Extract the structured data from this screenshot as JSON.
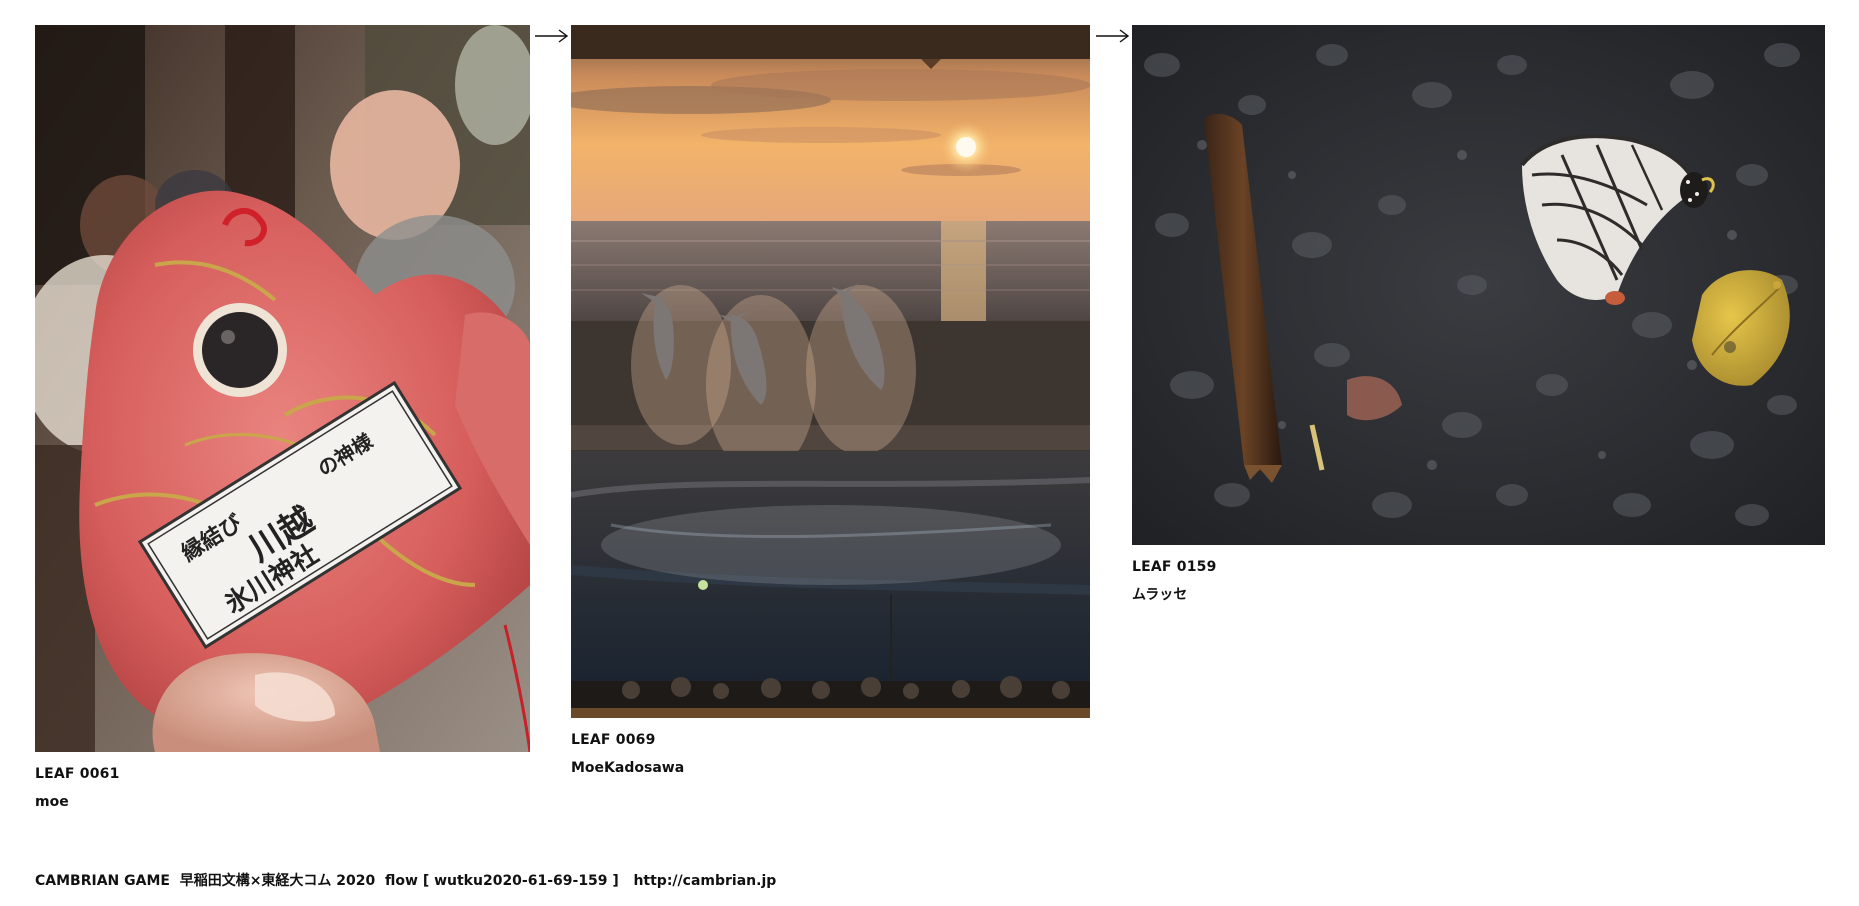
{
  "leaves": [
    {
      "id": "LEAF 0061",
      "author": "moe",
      "image": {
        "subject": "red sea-bream charm with paper label",
        "label_text": [
          "縁結び",
          "川越",
          "氷川神社",
          "の神様"
        ]
      }
    },
    {
      "id": "LEAF 0069",
      "author": "MoeKadosawa",
      "image": {
        "subject": "dolphins jumping at sunset aquarium show"
      }
    },
    {
      "id": "LEAF 0159",
      "author": "ムラッセ",
      "image": {
        "subject": "butterfly, twig and yellow leaf on wet asphalt"
      }
    }
  ],
  "arrows": [
    "right-arrow-icon",
    "right-arrow-icon"
  ],
  "footer": {
    "text": "CAMBRIAN GAME  早稲田文構×東経大コム 2020  flow [ wutku2020-61-69-159 ]   ",
    "link": "http://cambrian.jp"
  },
  "colors": {
    "background": "#ffffff",
    "text": "#111111",
    "charm_red": "#d9605f",
    "sunset": "#f2b36a",
    "asphalt": "#2b2d31"
  }
}
